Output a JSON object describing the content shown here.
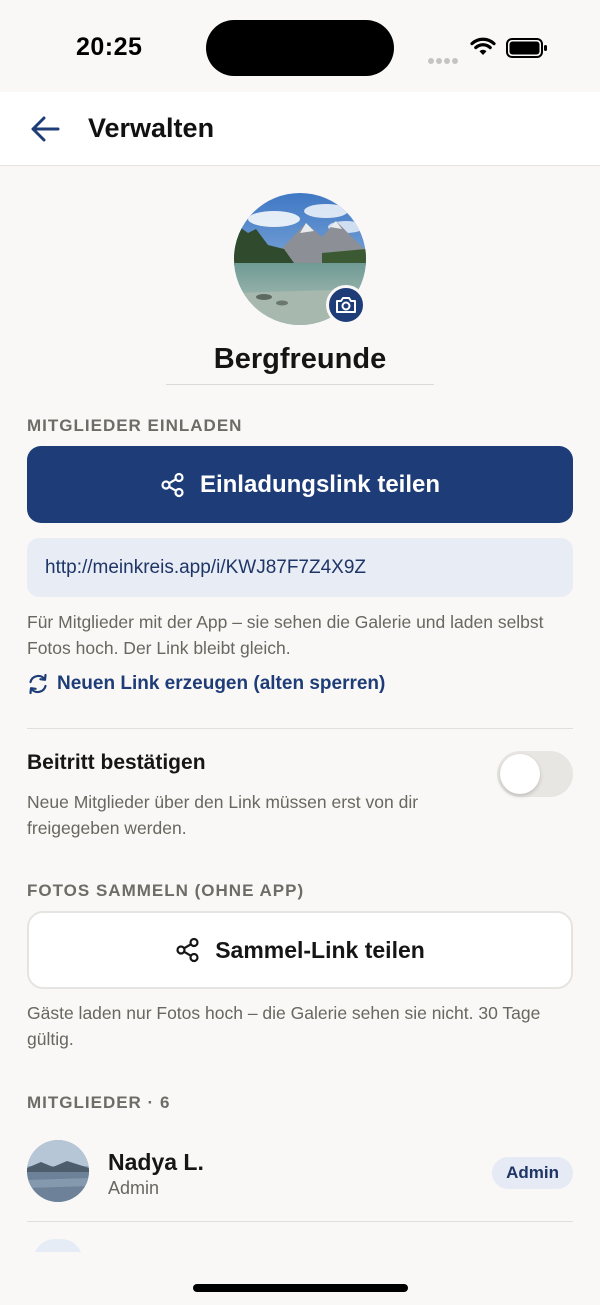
{
  "status_bar": {
    "time": "20:25"
  },
  "nav": {
    "title": "Verwalten"
  },
  "group": {
    "name": "Bergfreunde"
  },
  "invite": {
    "section_label": "MITGLIEDER EINLADEN",
    "share_button_label": "Einladungslink teilen",
    "link_url": "http://meinkreis.app/i/KWJ87F7Z4X9Z",
    "helper_text": "Für Mitglieder mit der App – sie sehen die Galerie und laden selbst Fotos hoch. Der Link bleibt gleich.",
    "regenerate_label": "Neuen Link erzeugen (alten sperren)"
  },
  "approval": {
    "title": "Beitritt bestätigen",
    "description": "Neue Mitglieder über den Link müssen erst von dir freigegeben werden.",
    "enabled": false
  },
  "collect": {
    "section_label": "FOTOS SAMMELN (OHNE APP)",
    "share_button_label": "Sammel-Link teilen",
    "helper_text": "Gäste laden nur Fotos hoch – die Galerie sehen sie nicht. 30 Tage gültig."
  },
  "members": {
    "section_label": "MITGLIEDER · 6",
    "items": [
      {
        "name": "Nadya L.",
        "role": "Admin",
        "badge": "Admin"
      }
    ]
  },
  "colors": {
    "accent": "#1e3d78",
    "background": "#f9f8f6",
    "link_box": "#e8ecf5"
  },
  "icons": [
    "back-arrow-icon",
    "camera-icon",
    "share-icon",
    "refresh-icon",
    "wifi-icon",
    "battery-icon"
  ]
}
